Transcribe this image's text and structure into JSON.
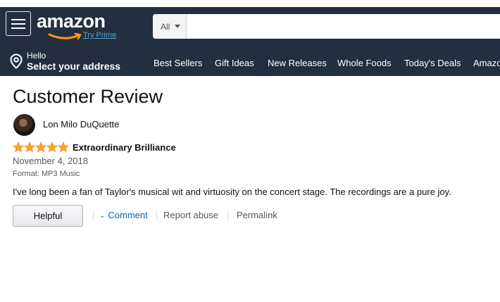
{
  "header": {
    "logo_text": "amazon",
    "prime_link": "Try Prime",
    "search": {
      "category": "All",
      "query": "",
      "placeholder": ""
    },
    "address": {
      "hello": "Hello",
      "select": "Select your address"
    },
    "nav": [
      "Best Sellers",
      "Gift Ideas",
      "New Releases",
      "Whole Foods",
      "Today's Deals",
      "Amazon"
    ]
  },
  "review": {
    "page_title": "Customer Review",
    "author": "Lon Milo DuQuette",
    "rating": 5,
    "rating_max": 5,
    "title": "Extraordinary Brilliance",
    "date": "November 4, 2018",
    "format": "Format: MP3 Music",
    "body": "I've long been a fan of Taylor's musical wit and virtuosity on the concert stage. The recordings are a pure joy.",
    "actions": {
      "helpful": "Helpful",
      "comment": "Comment",
      "report": "Report abuse",
      "permalink": "Permalink"
    }
  },
  "colors": {
    "header_bg": "#232f3e",
    "star": "#ffa41c",
    "link": "#0066c0",
    "prime": "#4ea8d2"
  }
}
